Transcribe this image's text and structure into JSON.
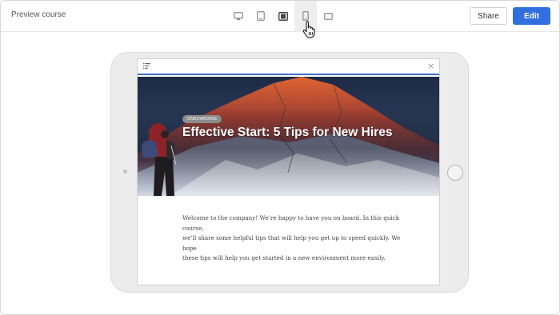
{
  "header": {
    "title": "Preview course",
    "devices": [
      "desktop",
      "laptop",
      "tablet-landscape",
      "tablet-portrait",
      "phone-landscape"
    ],
    "active_device": "tablet-portrait",
    "share_label": "Share",
    "edit_label": "Edit"
  },
  "course": {
    "badge": "ONBOARDING",
    "title": "Effective Start: 5 Tips for New Hires",
    "intro_lines": [
      "Welcome to the company! We’re happy to have you on board. In this quick course,",
      "we’ll share some helpful tips that will help you get up to speed quickly. We hope",
      "these tips will help you get started in a new environment more easily."
    ]
  },
  "icons": {
    "menu": "menu-lines-icon",
    "close": "close-icon",
    "cursor": "hand-pointer-icon"
  },
  "colors": {
    "accent": "#2f6fde",
    "screen_top_border": "#3f6fd0",
    "badge": "#8c8c8c"
  }
}
